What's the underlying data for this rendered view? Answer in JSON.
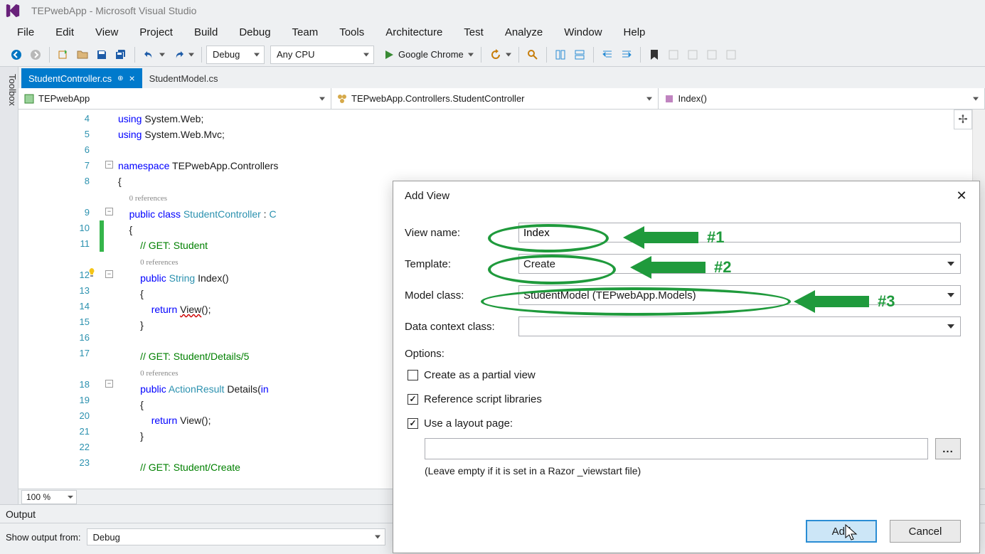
{
  "title": "TEPwebApp - Microsoft Visual Studio",
  "menubar": [
    "File",
    "Edit",
    "View",
    "Project",
    "Build",
    "Debug",
    "Team",
    "Tools",
    "Architecture",
    "Test",
    "Analyze",
    "Window",
    "Help"
  ],
  "toolbar": {
    "config": "Debug",
    "platform": "Any CPU",
    "run_target": "Google Chrome"
  },
  "toolbox_label": "Toolbox",
  "tabs": {
    "active": "StudentController.cs",
    "inactive": "StudentModel.cs"
  },
  "nav": {
    "project": "TEPwebApp",
    "class": "TEPwebApp.Controllers.StudentController",
    "member": "Index()"
  },
  "code": {
    "lines": [
      {
        "n": 4,
        "html": "<span class='kw'>using</span> System.Web;"
      },
      {
        "n": 5,
        "html": "<span class='kw'>using</span> System.Web.Mvc;"
      },
      {
        "n": 6,
        "html": ""
      },
      {
        "n": 7,
        "html": "<span class='kw'>namespace</span> TEPwebApp.Controllers"
      },
      {
        "n": 8,
        "html": "{"
      },
      {
        "n": "",
        "html": "    <span class='refs'>0 references</span>"
      },
      {
        "n": 9,
        "html": "    <span class='kw'>public</span> <span class='kw'>class</span> <span class='typ'>StudentController</span> : <span class='typ'>C</span>"
      },
      {
        "n": 10,
        "html": "    {"
      },
      {
        "n": 11,
        "html": "        <span class='cm'>// GET: Student</span>"
      },
      {
        "n": "",
        "html": "        <span class='refs'>0 references</span>"
      },
      {
        "n": 12,
        "html": "        <span class='kw'>public</span> <span class='typ'>String</span> Index()"
      },
      {
        "n": 13,
        "html": "        {"
      },
      {
        "n": 14,
        "html": "            <span class='kw'>return</span> <span class='err'>View</span>();"
      },
      {
        "n": 15,
        "html": "        }"
      },
      {
        "n": 16,
        "html": ""
      },
      {
        "n": 17,
        "html": "        <span class='cm'>// GET: Student/Details/5</span>"
      },
      {
        "n": "",
        "html": "        <span class='refs'>0 references</span>"
      },
      {
        "n": 18,
        "html": "        <span class='kw'>public</span> <span class='typ'>ActionResult</span> Details(<span class='kw'>in</span>"
      },
      {
        "n": 19,
        "html": "        {"
      },
      {
        "n": 20,
        "html": "            <span class='kw'>return</span> View();"
      },
      {
        "n": 21,
        "html": "        }"
      },
      {
        "n": 22,
        "html": ""
      },
      {
        "n": 23,
        "html": "        <span class='cm'>// GET: Student/Create</span>"
      }
    ]
  },
  "zoom": "100 %",
  "output": {
    "title": "Output",
    "from_label": "Show output from:",
    "from_value": "Debug"
  },
  "dialog": {
    "title": "Add View",
    "view_name_label": "View name:",
    "view_name_value": "Index",
    "template_label": "Template:",
    "template_value": "Create",
    "model_label": "Model class:",
    "model_value": "StudentModel (TEPwebApp.Models)",
    "context_label": "Data context class:",
    "context_value": "",
    "options_label": "Options:",
    "chk_partial": "Create as a partial view",
    "chk_scripts": "Reference script libraries",
    "chk_layout": "Use a layout page:",
    "layout_value": "",
    "browse": "...",
    "hint": "(Leave empty if it is set in a Razor _viewstart file)",
    "add": "Add",
    "cancel": "Cancel"
  },
  "annotations": {
    "a1": "#1",
    "a2": "#2",
    "a3": "#3"
  }
}
